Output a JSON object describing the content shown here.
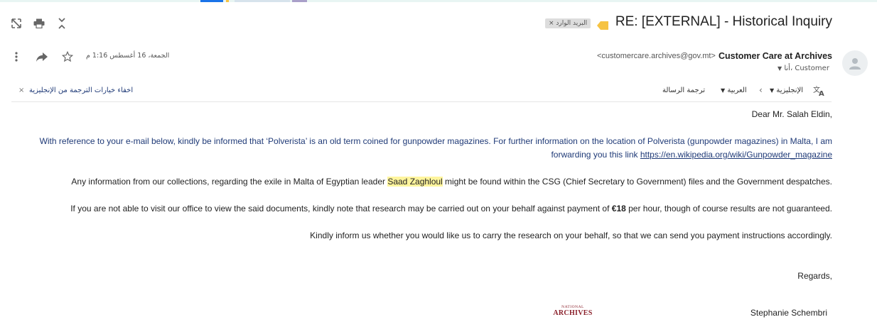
{
  "colors": {
    "accent_blue": "#1a73e8",
    "body_blue": "#1f3a77",
    "highlight": "#fff59d",
    "star_marker": "#f6c343",
    "logo_red": "#8a1f2a"
  },
  "toolbar": {
    "icons": [
      "open-in-new-window-icon",
      "print-icon",
      "collapse-all-icon"
    ]
  },
  "header": {
    "subject": "RE: [EXTERNAL] - Historical Inquiry",
    "label_chip": "البريد الوارد",
    "label_chip_close": "×",
    "importance_icon": "importance-marker-icon"
  },
  "sender": {
    "name": "Customer Care at Archives",
    "email": "<customercare.archives@gov.mt>",
    "to_label": "أنا، Customer",
    "date": "الجمعة، 16 أغسطس 1:16 م"
  },
  "translate_bar": {
    "from_lang": "الإنجليزية",
    "to_lang": "العربية",
    "translate_label": "ترجمة الرسالة",
    "hide_label": "اخفاء خيارات الترجمة من الإنجليزية",
    "close_symbol": "×"
  },
  "message": {
    "greeting": "Dear Mr. Salah Eldin,",
    "para1_line1": "With reference to your e-mail below, kindly be informed that ‘Polverista’ is an old term coined for gunpowder magazines. For further information on the location of Polverista (gunpowder magazines) in Malta, I am",
    "para1_line2_prefix": "forwarding you this link ",
    "link": "https://en.wikipedia.org/wiki/Gunpowder_magazine",
    "para2_prefix": "Any information from our collections, regarding the exile in Malta of Egyptian leader ",
    "para2_highlight": "Saad Zaghloul",
    "para2_suffix": " might be found within the CSG (Chief Secretary to Government) files and the Government despatches.",
    "para3_prefix": "If you are not able to visit our office to view the said documents, kindly note that research may be carried out on your behalf against payment of ",
    "para3_price": "€18",
    "para3_suffix": " per hour, though of course results are not guaranteed.",
    "para4": "Kindly inform us whether you would like us to carry the research on your behalf, so that we can send you payment instructions accordingly.",
    "regards": "Regards,",
    "signature": "Stephanie Schembri"
  },
  "logo": {
    "small": "NATIONAL",
    "big": "ARCHIVES"
  }
}
